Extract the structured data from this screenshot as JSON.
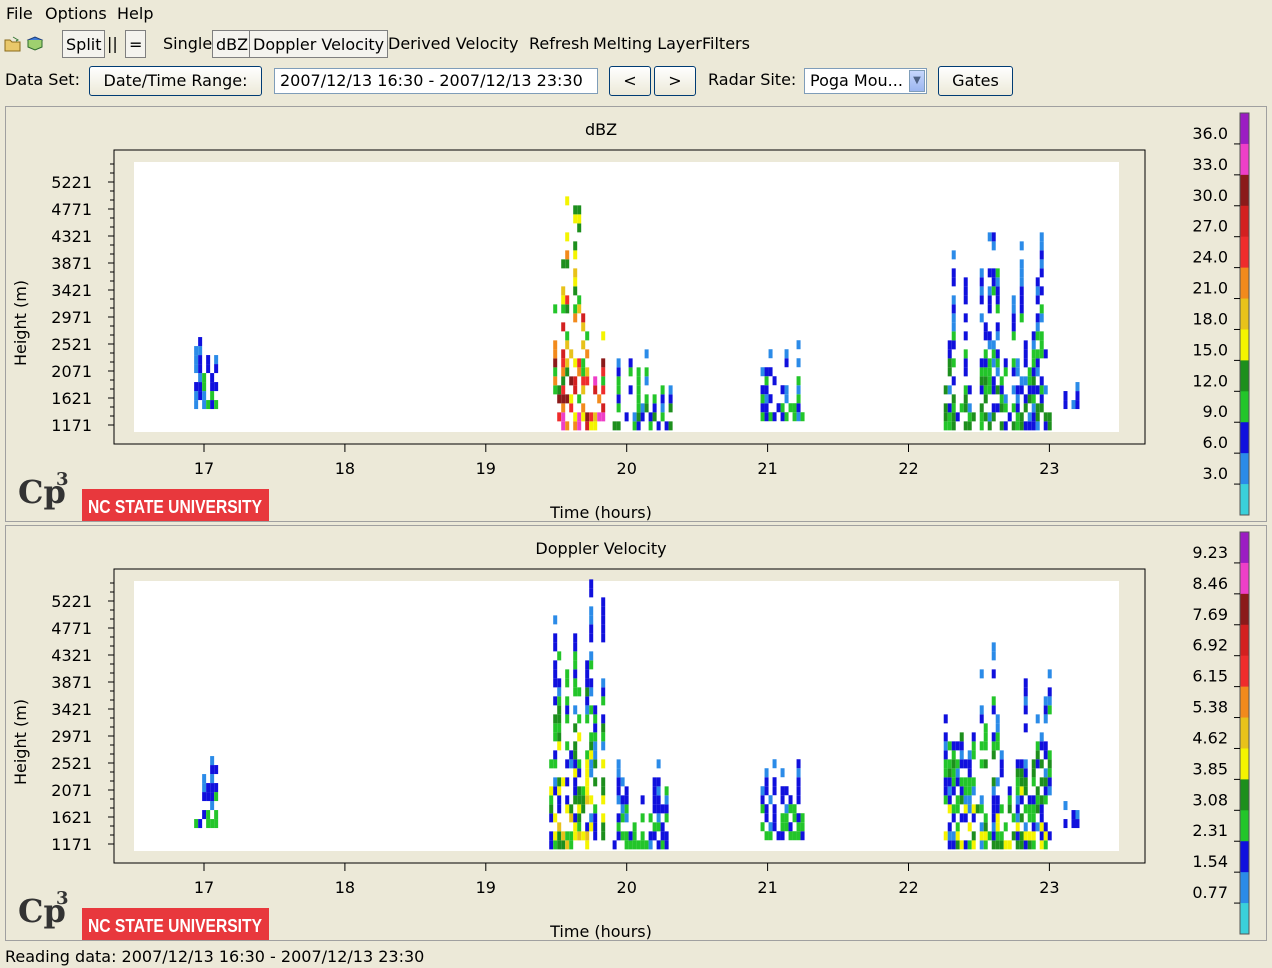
{
  "menu": {
    "items": [
      "File",
      "Options",
      "Help"
    ]
  },
  "toolbar": {
    "split": "Split",
    "parallel": "||",
    "equals": "=",
    "single": "Single",
    "dbz": "dBZ",
    "doppler": "Doppler Velocity",
    "derived": "Derived Velocity",
    "refresh": "Refresh",
    "melting": "Melting Layer",
    "filters": "Filters"
  },
  "dataset": {
    "label": "Data Set:",
    "range_button": "Date/Time Range:",
    "range_value": "2007/12/13 16:30 - 2007/12/13 23:30",
    "prev": "<",
    "next": ">",
    "site_label": "Radar Site:",
    "site_value": "Poga Mou...",
    "gates": "Gates"
  },
  "logo": {
    "text": "Cp3",
    "university": "NC STATE UNIVERSITY",
    "university_color": "#e8383d"
  },
  "status": "Reading data: 2007/12/13 16:30 - 2007/12/13 23:30",
  "chart_data": [
    {
      "type": "heatmap",
      "title": "dBZ",
      "xlabel": "Time (hours)",
      "ylabel": "Height (m)",
      "xticks": [
        17,
        18,
        19,
        20,
        21,
        22,
        23
      ],
      "yticks": [
        1171,
        1621,
        2071,
        2521,
        2971,
        3421,
        3871,
        4321,
        4771,
        5221
      ],
      "xlim": [
        16.5,
        23.5
      ],
      "ylim": [
        850,
        5700
      ],
      "colorbar": {
        "labels": [
          "36.0",
          "33.0",
          "30.0",
          "27.0",
          "24.0",
          "21.0",
          "18.0",
          "15.0",
          "12.0",
          "9.0",
          "6.0",
          "3.0"
        ],
        "colors": [
          "#9b1dc2",
          "#ee3fc8",
          "#8b1a1a",
          "#d32020",
          "#ef2c2c",
          "#f28a1c",
          "#e8c21a",
          "#f4f400",
          "#1d8f1d",
          "#23c52a",
          "#1010dd",
          "#2b8be8",
          "#3ad0da"
        ]
      },
      "series": [
        {
          "x": [
            16.93,
            17.1
          ],
          "ylo": 1400,
          "yhi": 2700,
          "level": [
            1,
            2,
            3
          ]
        },
        {
          "x": [
            19.45,
            19.82
          ],
          "ylo": 1050,
          "yhi": 5650,
          "level": [
            3,
            4,
            5,
            6,
            7,
            8,
            9,
            10,
            11
          ]
        },
        {
          "x": [
            19.9,
            20.3
          ],
          "ylo": 1050,
          "yhi": 2700,
          "level": [
            1,
            2,
            3,
            4
          ]
        },
        {
          "x": [
            20.95,
            21.25
          ],
          "ylo": 1200,
          "yhi": 2500,
          "level": [
            1,
            2,
            3
          ]
        },
        {
          "x": [
            22.25,
            23.0
          ],
          "ylo": 1050,
          "yhi": 4350,
          "level": [
            1,
            2,
            3,
            4
          ]
        },
        {
          "x": [
            23.1,
            23.2
          ],
          "ylo": 1400,
          "yhi": 1800,
          "level": [
            1,
            2
          ]
        }
      ]
    },
    {
      "type": "heatmap",
      "title": "Doppler Velocity",
      "xlabel": "Time (hours)",
      "ylabel": "Height (m)",
      "xticks": [
        17,
        18,
        19,
        20,
        21,
        22,
        23
      ],
      "yticks": [
        1171,
        1621,
        2071,
        2521,
        2971,
        3421,
        3871,
        4321,
        4771,
        5221
      ],
      "xlim": [
        16.5,
        23.5
      ],
      "ylim": [
        850,
        5700
      ],
      "colorbar": {
        "labels": [
          "9.23",
          "8.46",
          "7.69",
          "6.92",
          "6.15",
          "5.38",
          "4.62",
          "3.85",
          "3.08",
          "2.31",
          "1.54",
          "0.77"
        ],
        "colors": [
          "#9b1dc2",
          "#ee3fc8",
          "#8b1a1a",
          "#d32020",
          "#ef2c2c",
          "#f28a1c",
          "#e8c21a",
          "#f4f400",
          "#1d8f1d",
          "#23c52a",
          "#1010dd",
          "#2b8be8",
          "#3ad0da"
        ]
      },
      "series": [
        {
          "x": [
            16.93,
            17.1
          ],
          "ylo": 1400,
          "yhi": 2700,
          "level": [
            1,
            2,
            3
          ]
        },
        {
          "x": [
            19.45,
            19.82
          ],
          "ylo": 1050,
          "yhi": 5650,
          "level": [
            1,
            2,
            3,
            4,
            5,
            6
          ]
        },
        {
          "x": [
            19.9,
            20.3
          ],
          "ylo": 1050,
          "yhi": 2700,
          "level": [
            1,
            2,
            3
          ]
        },
        {
          "x": [
            20.95,
            21.25
          ],
          "ylo": 1200,
          "yhi": 2500,
          "level": [
            1,
            2,
            3
          ]
        },
        {
          "x": [
            22.25,
            23.0
          ],
          "ylo": 1050,
          "yhi": 4350,
          "level": [
            1,
            2,
            3,
            4,
            5
          ]
        },
        {
          "x": [
            23.1,
            23.2
          ],
          "ylo": 1400,
          "yhi": 1800,
          "level": [
            1,
            2
          ]
        }
      ]
    }
  ]
}
